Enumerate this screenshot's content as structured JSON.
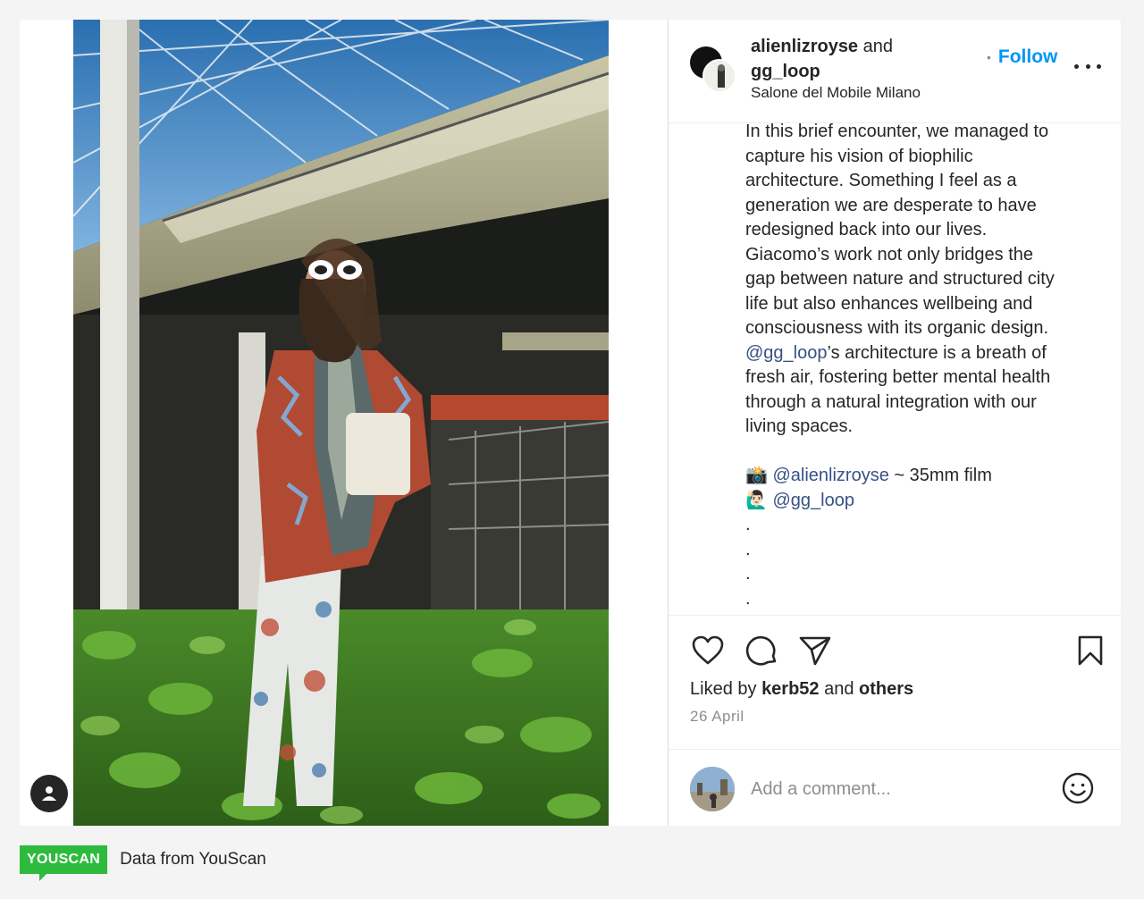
{
  "post": {
    "author1": "alienlizroyse",
    "and_word": " and",
    "author2": "gg_loop",
    "location": "Salone del Mobile Milano",
    "follow_separator": "•",
    "follow_label": "Follow"
  },
  "caption": {
    "p1_lines": [
      "In this brief encounter, we managed to",
      "capture his vision of biophilic",
      "architecture. Something I feel as a",
      "generation we are desperate to have",
      "redesigned back into our lives.",
      "Giacomo’s work not only bridges the",
      "gap between nature and structured city",
      "life but also enhances wellbeing and",
      "consciousness with its organic design."
    ],
    "mention_gg": "@gg_loop",
    "p2_rest_first": "’s architecture is a breath of",
    "p2_lines": [
      "fresh air, fostering better mental health",
      "through a natural integration with our",
      "living spaces."
    ],
    "credit1_emoji": "📸",
    "credit1_mention": "@alienlizroyse",
    "credit1_rest": " ~ 35mm film",
    "credit2_emoji": "🙋🏻‍♂️",
    "credit2_mention": "@gg_loop",
    "dots": [
      ".",
      ".",
      ".",
      "."
    ]
  },
  "engagement": {
    "liked_by_prefix": "Liked by ",
    "liked_by_user": "kerb52",
    "liked_by_and": " and ",
    "liked_by_others": "others",
    "date": "26 April"
  },
  "comment": {
    "placeholder": "Add a comment..."
  },
  "icons": {
    "like": "heart-icon",
    "comment": "comment-icon",
    "share": "send-icon",
    "save": "bookmark-icon",
    "more": "more-options-icon",
    "emoji": "smiley-icon",
    "user": "user-icon"
  },
  "footer": {
    "logo": "YOUSCAN",
    "text": "Data from YouScan"
  },
  "colors": {
    "follow": "#0095f6",
    "mention": "#385185",
    "youscan_green": "#2ebb3d"
  }
}
